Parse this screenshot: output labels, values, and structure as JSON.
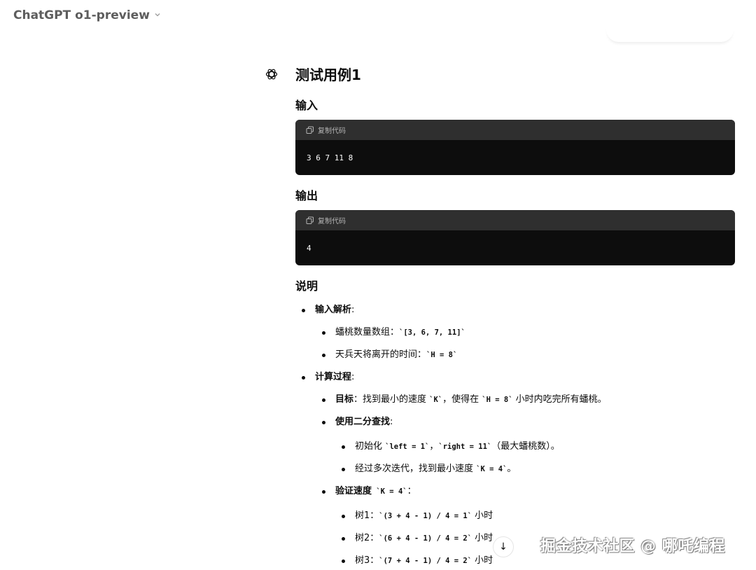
{
  "header": {
    "model_name": "ChatGPT o1-preview",
    "chevron": "chevron-down-icon"
  },
  "assistant": {
    "avatar_icon": "openai-logo-icon"
  },
  "message": {
    "title": "测试用例1",
    "input_heading": "输入",
    "input_code": {
      "copy_label": "复制代码",
      "code": "3 6 7 11 8"
    },
    "output_heading": "输出",
    "output_code": {
      "copy_label": "复制代码",
      "code": "4"
    },
    "explain_heading": "说明"
  },
  "list": {
    "b1": {
      "bold": "输入解析",
      "rest": ":"
    },
    "b1_1": {
      "text": "蟠桃数量数组：",
      "code": "`[3, 6, 7, 11]`"
    },
    "b1_2": {
      "text": "天兵天将离开的时间：",
      "code": "`H = 8`"
    },
    "b2": {
      "bold": "计算过程",
      "rest": ":"
    },
    "b2_1": {
      "bold": "目标",
      "t1": "：找到最小的速度 ",
      "c1": "`K`",
      "t2": "，使得在 ",
      "c2": "`H = 8`",
      "t3": " 小时内吃完所有蟠桃。"
    },
    "b2_2": {
      "bold": "使用二分查找",
      "rest": ":"
    },
    "b2_2_1": {
      "t1": "初始化 ",
      "c1": "`left = 1`",
      "t2": "，",
      "c2": "`right = 11`",
      "t3": "（最大蟠桃数）。"
    },
    "b2_2_2": {
      "t1": "经过多次迭代，找到最小速度 ",
      "c1": "`K = 4`",
      "t2": "。"
    },
    "b2_3": {
      "bold": "验证速度",
      "c1": " `K = 4`",
      "rest": "："
    },
    "b2_3_1": {
      "t1": "树1：",
      "c1": "`(3 + 4 - 1) / 4 = 1`",
      "t2": " 小时"
    },
    "b2_3_2": {
      "t1": "树2：",
      "c1": "`(6 + 4 - 1) / 4 = 2`",
      "t2": " 小时"
    },
    "b2_3_3": {
      "t1": "树3：",
      "c1": "`(7 + 4 - 1) / 4 = 2`",
      "t2": " 小时"
    }
  },
  "watermark": "掘金技术社区 @ 哪吒编程",
  "scroll_button": "↓"
}
